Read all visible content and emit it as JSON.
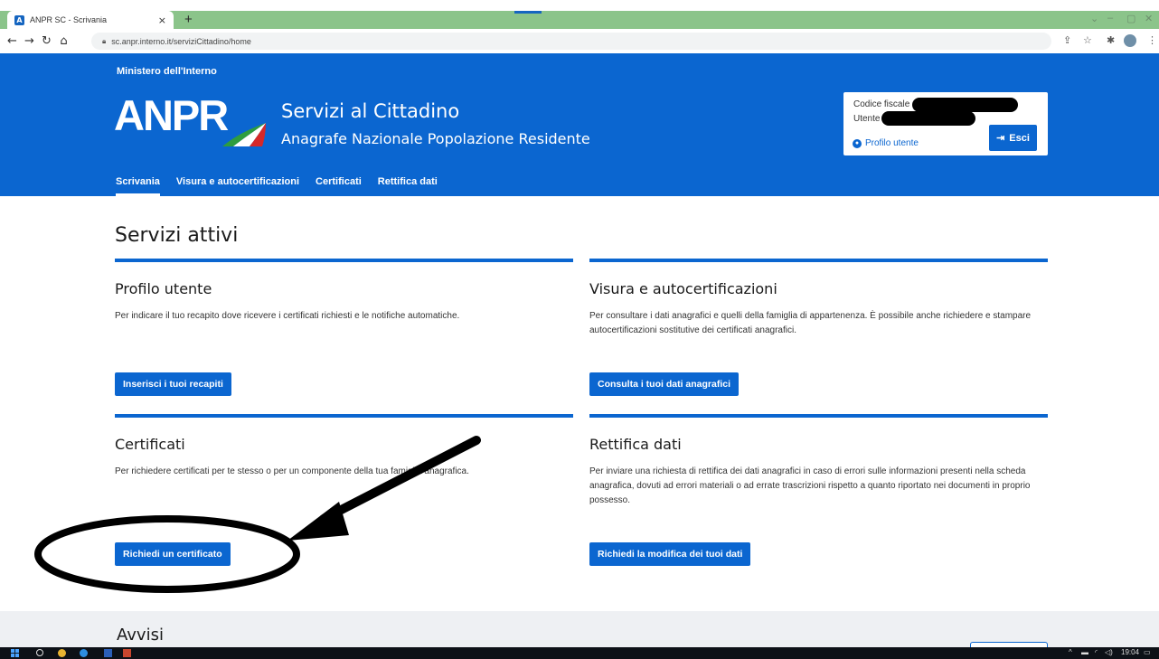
{
  "browser": {
    "tab_title": "ANPR SC - Scrivania",
    "tab_close": "×",
    "new_tab": "+",
    "url": "sc.anpr.interno.it/serviziCittadino/home"
  },
  "header": {
    "ministry": "Ministero dell'Interno",
    "logo_text": "ANPR",
    "service_title": "Servizi al Cittadino",
    "service_subtitle": "Anagrafe Nazionale Popolazione Residente",
    "user_box": {
      "codice_fiscale_label": "Codice fiscale",
      "utente_label": "Utente",
      "profile_link": "Profilo utente",
      "logout_label": "Esci"
    },
    "nav": [
      "Scrivania",
      "Visura e autocertificazioni",
      "Certificati",
      "Rettifica dati"
    ]
  },
  "main": {
    "title": "Servizi attivi",
    "cards": [
      {
        "title": "Profilo utente",
        "description": "Per indicare il tuo recapito dove ricevere i certificati richiesti e le notifiche automatiche.",
        "button": "Inserisci i tuoi recapiti"
      },
      {
        "title": "Visura e autocertificazioni",
        "description": "Per consultare i dati anagrafici e quelli della famiglia di appartenenza. È possibile anche richiedere e stampare autocertificazioni sostitutive dei certificati anagrafici.",
        "button": "Consulta i tuoi dati anagrafici"
      },
      {
        "title": "Certificati",
        "description": "Per richiedere certificati per te stesso o per un componente della tua famiglia anagrafica.",
        "button": "Richiedi un certificato"
      },
      {
        "title": "Rettifica dati",
        "description": "Per inviare una richiesta di rettifica dei dati anagrafici in caso di errori sulle informazioni presenti nella scheda anagrafica, dovuti ad errori materiali o ad errate trascrizioni rispetto a quanto riportato nei documenti in proprio possesso.",
        "button": "Richiedi la modifica dei tuoi dati"
      }
    ],
    "notices_title": "Avvisi"
  },
  "taskbar": {
    "time": "19:04"
  },
  "colors": {
    "brand_blue": "#0b66d0",
    "tab_strip": "#8bc48a",
    "annotation": "#000000"
  }
}
